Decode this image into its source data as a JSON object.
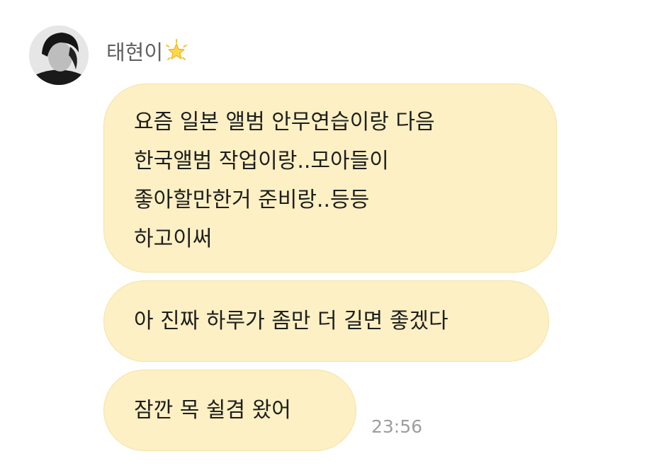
{
  "chat": {
    "sender": {
      "name": "태현이",
      "badge_icon": "glowing-star-icon"
    },
    "messages": [
      {
        "lines": [
          "요즘 일본 앨범 안무연습이랑 다음",
          "한국앨범 작업이랑..모아들이",
          "좋아할만한거 준비랑..등등",
          "하고이써"
        ]
      },
      {
        "lines": [
          "아 진짜 하루가 좀만 더 길면 좋겠다"
        ]
      },
      {
        "lines": [
          "잠깐 목 쉴겸 왔어"
        ]
      }
    ],
    "timestamp": "23:56"
  },
  "colors": {
    "bubble": "#fcf0c4",
    "bubble_border": "#f4e4a6",
    "name_text": "#5f5f5f",
    "time_text": "#9e9e9e"
  }
}
